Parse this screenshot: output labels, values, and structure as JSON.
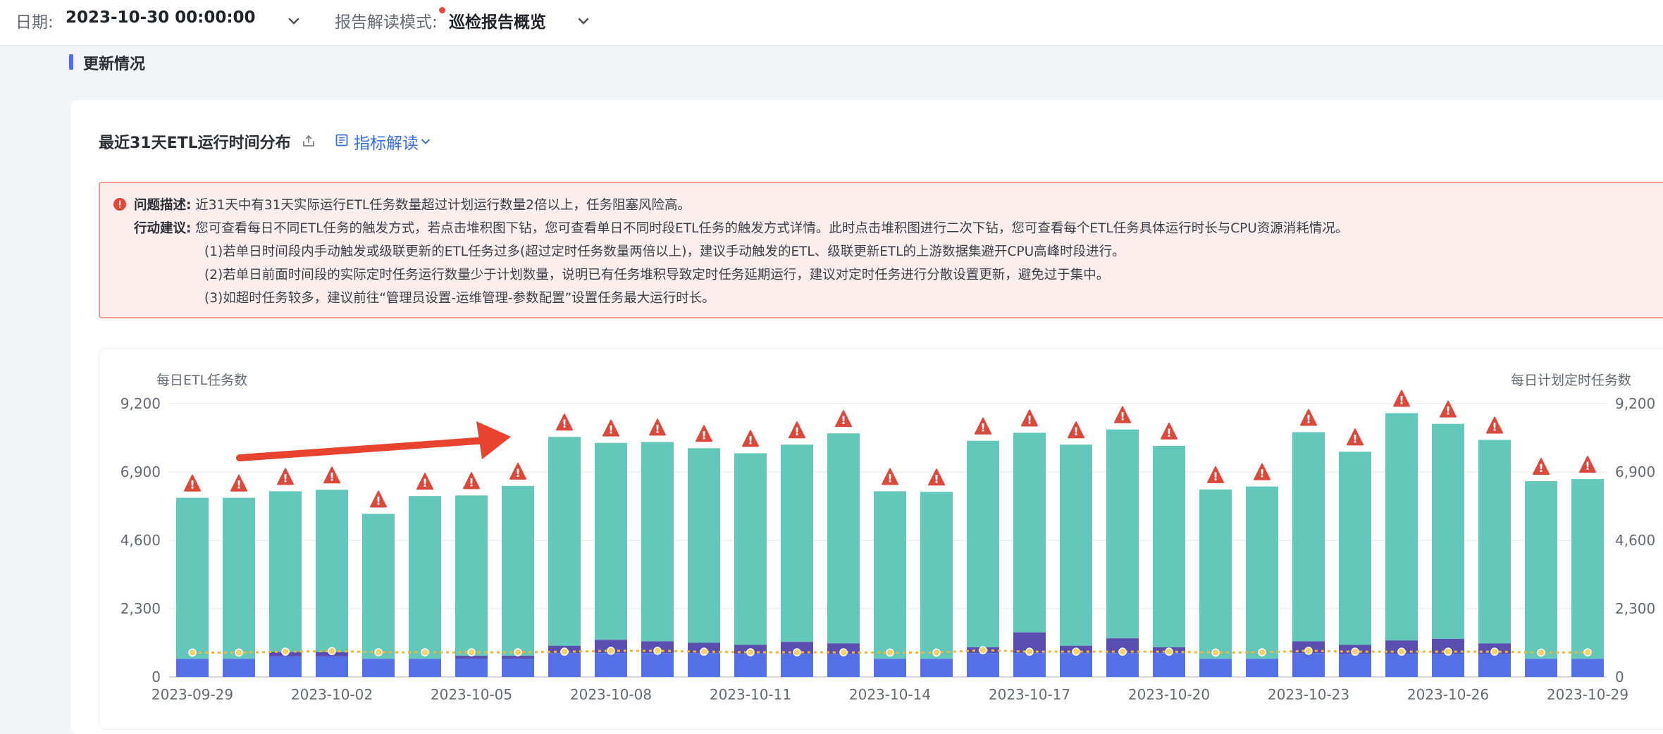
{
  "topbar": {
    "date_label": "日期:",
    "date_value": "2023-10-30 00:00:00",
    "mode_label": "报告解读模式:",
    "mode_value": "巡检报告概览"
  },
  "section": {
    "title": "更新情况"
  },
  "card": {
    "title": "最近31天ETL运行时间分布",
    "guide_link": "指标解读"
  },
  "alert": {
    "problem_key": "问题描述:",
    "problem_text": "近31天中有31天实际运行ETL任务数量超过计划运行数量2倍以上，任务阻塞风险高。",
    "action_key": "行动建议:",
    "action_text": "您可查看每日不同ETL任务的触发方式，若点击堆积图下钻，您可查看单日不同时段ETL任务的触发方式详情。此时点击堆积图进行二次下钻，您可查看每个ETL任务具体运行时长与CPU资源消耗情况。",
    "items": [
      "(1)若单日时间段内手动触发或级联更新的ETL任务过多(超过定时任务数量两倍以上)，建议手动触发的ETL、级联更新ETL的上游数据集避开CPU高峰时段进行。",
      "(2)若单日前面时间段的实际定时任务运行数量少于计划数量，说明已有任务堆积导致定时任务延期运行，建议对定时任务进行分散设置更新，避免过于集中。",
      "(3)如超时任务较多，建议前往“管理员设置-运维管理-参数配置”设置任务最大运行时长。"
    ]
  },
  "chart_data": {
    "type": "bar",
    "stacked": true,
    "y_left_label": "每日ETL任务数",
    "y_right_label": "每日计划定时任务数",
    "y_ticks": [
      0,
      2300,
      4600,
      6900,
      9200
    ],
    "y_tick_labels": [
      "0",
      "2,300",
      "4,600",
      "6,900",
      "9,200"
    ],
    "ylim": [
      0,
      9200
    ],
    "x_tick_labels": [
      "2023-09-29",
      "2023-10-02",
      "2023-10-05",
      "2023-10-08",
      "2023-10-11",
      "2023-10-14",
      "2023-10-17",
      "2023-10-20",
      "2023-10-23",
      "2023-10-26",
      "2023-10-29"
    ],
    "x_tick_every": 3,
    "bar_count": 31,
    "colors": {
      "blue": "#5470e6",
      "indigo": "#5a4fb0",
      "teal": "#63c8b9",
      "line": "#f2b535",
      "warn": "#d94a3c",
      "arrow": "#e8432f"
    },
    "blue_values": [
      610,
      610,
      690,
      690,
      610,
      610,
      610,
      610,
      800,
      800,
      800,
      800,
      780,
      780,
      780,
      610,
      610,
      800,
      800,
      800,
      800,
      800,
      610,
      610,
      800,
      780,
      780,
      780,
      780,
      610,
      610
    ],
    "indigo_values": [
      0,
      0,
      150,
      150,
      0,
      0,
      100,
      100,
      250,
      450,
      400,
      350,
      300,
      400,
      350,
      0,
      0,
      200,
      700,
      250,
      500,
      200,
      0,
      0,
      400,
      300,
      450,
      500,
      350,
      0,
      0
    ],
    "teal_values": [
      5420,
      5420,
      5410,
      5460,
      4880,
      5480,
      5400,
      5720,
      7030,
      6630,
      6710,
      6550,
      6450,
      6640,
      7070,
      5640,
      5620,
      6950,
      6720,
      6770,
      7030,
      6780,
      5700,
      5800,
      7040,
      6500,
      7650,
      7240,
      6850,
      5980,
      6050
    ],
    "line_values": [
      820,
      820,
      850,
      870,
      830,
      830,
      830,
      830,
      850,
      880,
      880,
      850,
      830,
      830,
      830,
      820,
      820,
      900,
      850,
      850,
      850,
      850,
      820,
      830,
      880,
      850,
      850,
      850,
      850,
      820,
      830
    ]
  }
}
